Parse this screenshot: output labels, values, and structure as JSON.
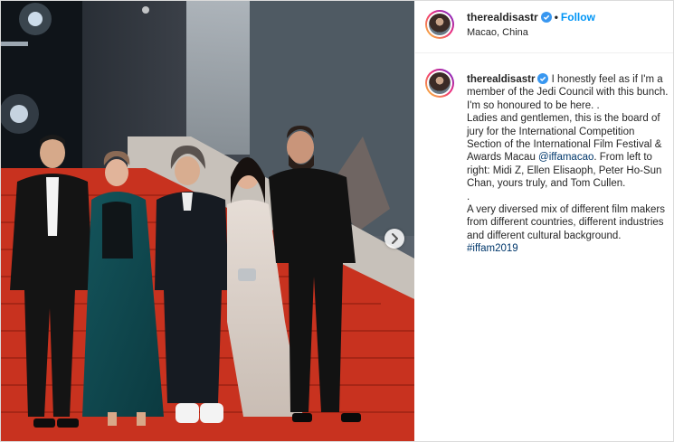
{
  "post": {
    "username": "therealdisastr",
    "follow_label": "Follow",
    "separator": "•",
    "location": "Macao, China",
    "photo_alt": "Jury members standing on red-carpeted steps",
    "colors": {
      "link": "#0095f6",
      "mention": "#00376b",
      "carpet": "#c8321f"
    }
  },
  "caption": {
    "username": "therealdisastr",
    "line1": "I honestly feel as if I'm a member of the Jedi Council with this bunch. I'm so honoured to be here. .",
    "line2_before": "Ladies and gentlemen, this is the board of jury for the International Competition Section of the International Film Festival & Awards Macau ",
    "mention": "@iffamacao",
    "line2_after": ". From left to right: Midi Z, Ellen Elisaoph, Peter Ho-Sun Chan, yours truly, and Tom Cullen.",
    "line3": ".",
    "line4_before": "A very diversed mix of different film makers from different countries, different industries and different cultural background. ",
    "hashtag": "#iffam2019"
  },
  "icons": {
    "verified": "verified-badge-icon",
    "next": "chevron-right-icon"
  }
}
